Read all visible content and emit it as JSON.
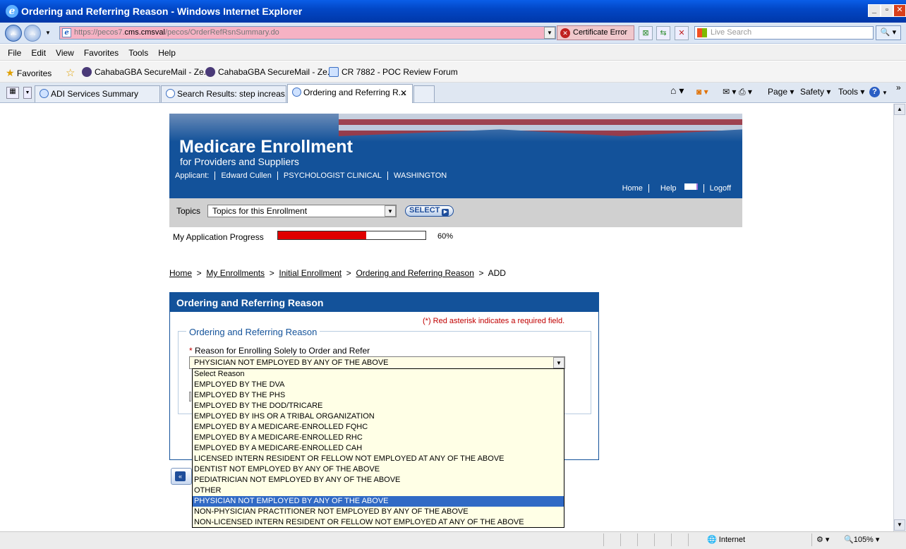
{
  "window": {
    "title": "Ordering and Referring Reason - Windows Internet Explorer"
  },
  "address": {
    "url_prefix": "https://pecos7.",
    "url_domain": "cms.cmsval",
    "url_path": "/pecos/OrderRefRsnSummary.do",
    "cert_error": "Certificate Error",
    "search_placeholder": "Live Search"
  },
  "menu": [
    "File",
    "Edit",
    "View",
    "Favorites",
    "Tools",
    "Help"
  ],
  "favorites": {
    "label": "Favorites",
    "items": [
      "CahabaGBA SecureMail - Ze...",
      "CahabaGBA SecureMail - Ze...",
      "CR 7882 - POC Review Forum"
    ]
  },
  "tabs": [
    {
      "label": "ADI Services Summary"
    },
    {
      "label": "Search Results: step increas..."
    },
    {
      "label": "Ordering and Referring R..."
    }
  ],
  "commands": {
    "page": "Page",
    "safety": "Safety",
    "tools": "Tools"
  },
  "banner": {
    "title": "Medicare Enrollment",
    "subtitle": "for Providers and Suppliers",
    "applicant_label": "Applicant:",
    "applicant_name": "Edward Cullen",
    "specialty": "PSYCHOLOGIST CLINICAL",
    "state": "WASHINGTON",
    "home": "Home",
    "help": "Help",
    "logoff": "Logoff"
  },
  "topics": {
    "label": "Topics",
    "selected": "Topics for this Enrollment",
    "button": "SELECT"
  },
  "progress": {
    "label": "My Application Progress",
    "percent_text": "60%",
    "value": 0.6
  },
  "breadcrumb": {
    "home": "Home",
    "my_enrollments": "My Enrollments",
    "initial_enrollment": "Initial Enrollment",
    "ordering": "Ordering and Referring Reason",
    "current": "ADD"
  },
  "form": {
    "panel_title": "Ordering and Referring Reason",
    "required_note": "(*) Red asterisk indicates a required field.",
    "legend": "Ordering and Referring Reason",
    "reason_label": "Reason for Enrolling Solely to Order and Refer",
    "reason_value": "PHYSICIAN NOT EMPLOYED BY ANY OF THE ABOVE",
    "options": [
      "Select Reason",
      "EMPLOYED BY THE DVA",
      "EMPLOYED BY THE PHS",
      "EMPLOYED BY THE DOD/TRICARE",
      "EMPLOYED BY IHS OR A TRIBAL ORGANIZATION",
      "EMPLOYED BY A MEDICARE-ENROLLED FQHC",
      "EMPLOYED BY A MEDICARE-ENROLLED RHC",
      "EMPLOYED BY A MEDICARE-ENROLLED CAH",
      "LICENSED INTERN RESIDENT OR FELLOW NOT EMPLOYED AT ANY OF THE ABOVE",
      "DENTIST NOT EMPLOYED BY ANY OF THE ABOVE",
      "PEDIATRICIAN NOT EMPLOYED BY ANY OF THE ABOVE",
      "OTHER",
      "PHYSICIAN NOT EMPLOYED BY ANY OF THE ABOVE",
      "NON-PHYSICIAN PRACTITIONER NOT EMPLOYED BY ANY OF THE ABOVE",
      "NON-LICENSED INTERN RESIDENT OR FELLOW NOT EMPLOYED AT ANY OF THE ABOVE"
    ],
    "selected_index": 12
  },
  "status": {
    "zone": "Internet",
    "zoom": "105%"
  }
}
